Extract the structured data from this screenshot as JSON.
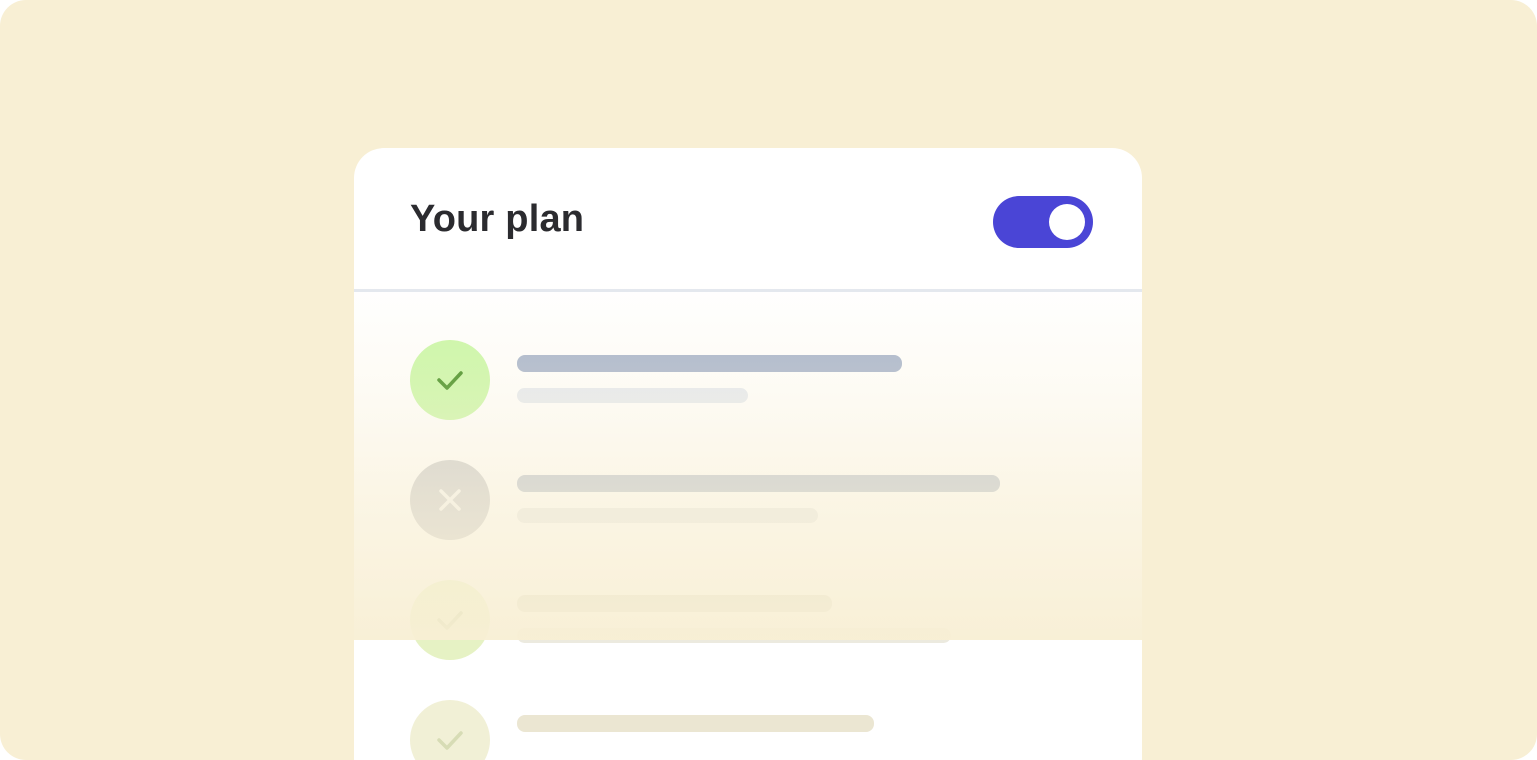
{
  "card": {
    "title": "Your plan",
    "toggle": {
      "state": "on",
      "color": "#4a45d6"
    }
  },
  "plan_items": [
    {
      "status": "included",
      "icon": "check-icon",
      "icon_bg": "#c9f7a6",
      "icon_color": "#3c8a1a",
      "bar_primary_color": "#a7b4cc",
      "bar_secondary_color": "#e4e9f1",
      "primary_bar_width": 0.55,
      "secondary_bar_width": 0.33
    },
    {
      "status": "excluded",
      "icon": "x-icon",
      "icon_bg": "#c8c9cd",
      "icon_color": "#f5f5f5",
      "bar_primary_color": "#b7c0d0",
      "bar_secondary_color": "#e8e9ea",
      "primary_bar_width": 0.69,
      "secondary_bar_width": 0.43
    },
    {
      "status": "included",
      "icon": "check-icon",
      "icon_bg": "#e6f2c4",
      "icon_color": "#a9bd7e",
      "bar_primary_color": "#d7d8cb",
      "bar_secondary_color": "#eceadf",
      "primary_bar_width": 0.45,
      "secondary_bar_width": 0.62
    },
    {
      "status": "included",
      "icon": "check-icon",
      "icon_bg": "#f1f0d6",
      "icon_color": "#d7dcb5",
      "bar_primary_color": "#ebe6d2",
      "bar_secondary_color": "#f3ecda",
      "primary_bar_width": 0.51,
      "secondary_bar_width": 0.0
    }
  ]
}
